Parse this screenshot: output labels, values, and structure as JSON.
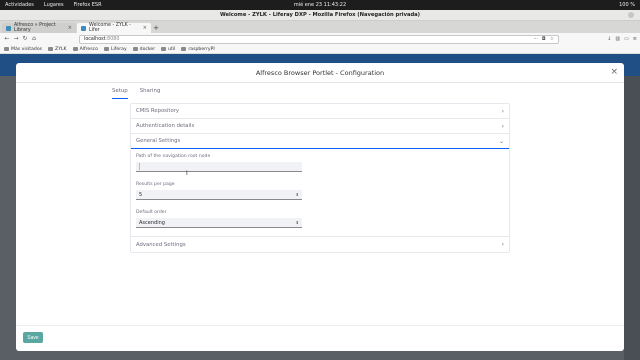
{
  "system_bar": {
    "activities": "Actividades",
    "places": "Lugares",
    "app": "Firefox ESR",
    "clock": "mié ene 23  11:43:22",
    "battery": "100 %"
  },
  "window": {
    "title": "Welcome - ZYLK - Liferay DXP - Mozilla Firefox (Navegación privada)"
  },
  "tabs": [
    {
      "label": "Alfresco » Project Library",
      "close": "×"
    },
    {
      "label": "Welcome - ZYLK - Lifer",
      "close": "×"
    }
  ],
  "new_tab": "+",
  "url": {
    "host": "localhost",
    "port": ":8080",
    "more": "···"
  },
  "bookmarks": [
    "Más visitados",
    "ZYLK",
    "Alfresco",
    "Liferay",
    "docker",
    "util",
    "raspberryPI"
  ],
  "modal": {
    "title": "Alfresco Browser Portlet - Configuration",
    "close": "×",
    "tabs": [
      "Setup",
      "Sharing"
    ],
    "sections": {
      "cmis": "CMIS Repository",
      "auth": "Authentication details",
      "general": "General Settings",
      "advanced": "Advanced Settings"
    },
    "fields": {
      "root_label": "Path of the navigation root node",
      "root_value": "",
      "results_label": "Results per page",
      "results_value": "5",
      "order_label": "Default order",
      "order_value": "Ascending"
    },
    "save": "Save"
  }
}
